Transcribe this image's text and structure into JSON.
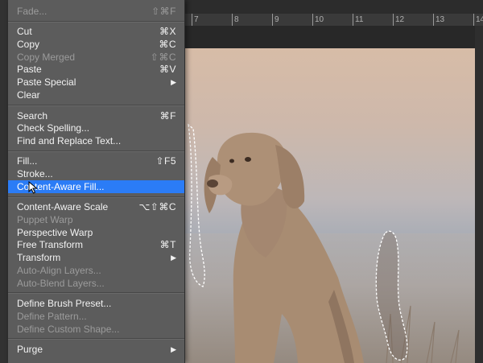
{
  "ruler": {
    "ticks": [
      "7",
      "8",
      "9",
      "10",
      "11",
      "12",
      "13",
      "14"
    ]
  },
  "menu": {
    "items": [
      {
        "id": "fade",
        "label": "Fade...",
        "shortcut": "⇧⌘F",
        "disabled": true
      },
      {
        "id": "cut",
        "label": "Cut",
        "shortcut": "⌘X"
      },
      {
        "id": "copy",
        "label": "Copy",
        "shortcut": "⌘C"
      },
      {
        "id": "copy-merged",
        "label": "Copy Merged",
        "shortcut": "⇧⌘C",
        "disabled": true
      },
      {
        "id": "paste",
        "label": "Paste",
        "shortcut": "⌘V"
      },
      {
        "id": "paste-special",
        "label": "Paste Special",
        "submenu": true
      },
      {
        "id": "clear",
        "label": "Clear"
      },
      {
        "id": "search",
        "label": "Search",
        "shortcut": "⌘F"
      },
      {
        "id": "check-spelling",
        "label": "Check Spelling..."
      },
      {
        "id": "find-replace",
        "label": "Find and Replace Text..."
      },
      {
        "id": "fill",
        "label": "Fill...",
        "shortcut": "⇧F5"
      },
      {
        "id": "stroke",
        "label": "Stroke..."
      },
      {
        "id": "content-aware-fill",
        "label": "Content-Aware Fill...",
        "highlighted": true
      },
      {
        "id": "content-aware-scale",
        "label": "Content-Aware Scale",
        "shortcut": "⌥⇧⌘C"
      },
      {
        "id": "puppet-warp",
        "label": "Puppet Warp",
        "disabled": true
      },
      {
        "id": "perspective-warp",
        "label": "Perspective Warp"
      },
      {
        "id": "free-transform",
        "label": "Free Transform",
        "shortcut": "⌘T"
      },
      {
        "id": "transform",
        "label": "Transform",
        "submenu": true
      },
      {
        "id": "auto-align",
        "label": "Auto-Align Layers...",
        "disabled": true
      },
      {
        "id": "auto-blend",
        "label": "Auto-Blend Layers...",
        "disabled": true
      },
      {
        "id": "define-brush",
        "label": "Define Brush Preset..."
      },
      {
        "id": "define-pattern",
        "label": "Define Pattern...",
        "disabled": true
      },
      {
        "id": "define-shape",
        "label": "Define Custom Shape...",
        "disabled": true
      },
      {
        "id": "purge",
        "label": "Purge",
        "submenu": true
      }
    ],
    "submenu_arrow": "▶"
  },
  "colors": {
    "menu_bg": "#5c5c5c",
    "highlight": "#2b7cf6",
    "disabled_text": "#9b9b9b",
    "dog": "#a88c72"
  },
  "icons": {
    "cursor": "arrow-cursor-icon"
  }
}
